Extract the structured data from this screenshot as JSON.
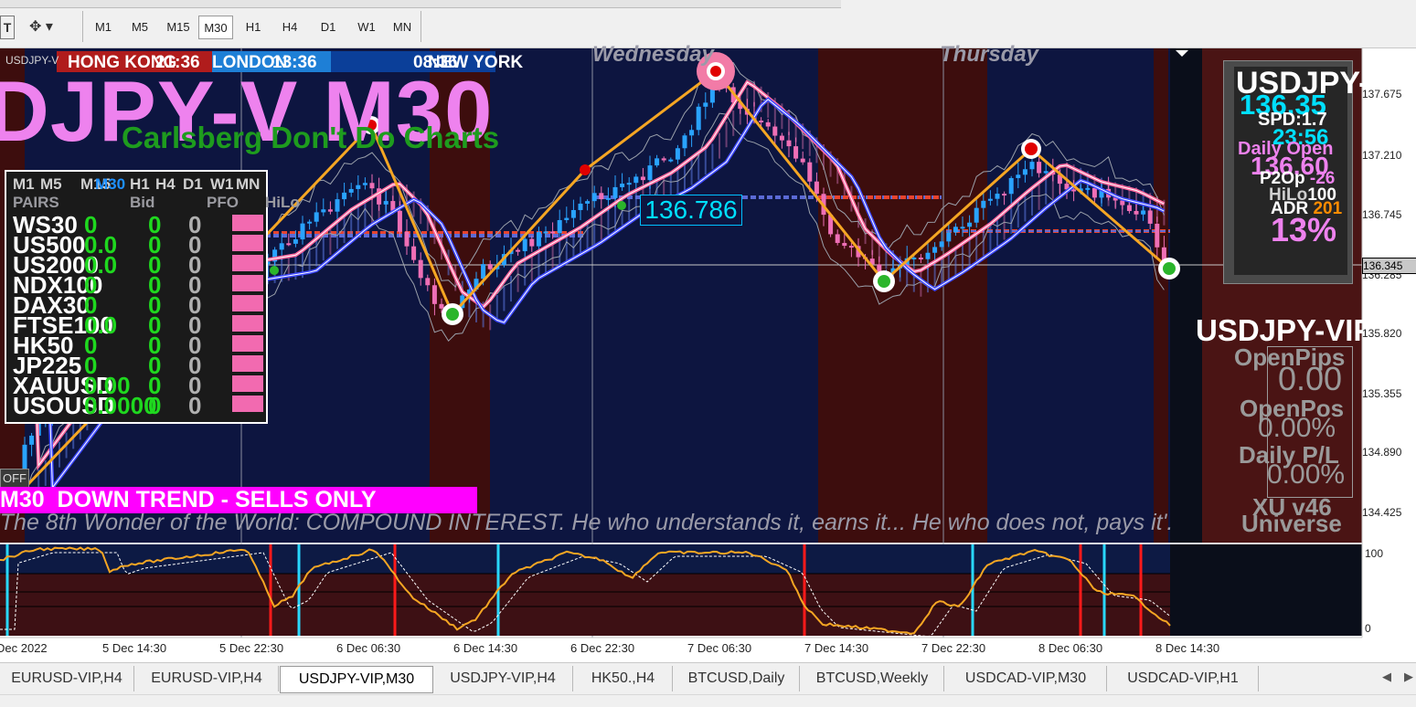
{
  "toolbar": {
    "timeframes": [
      "M1",
      "M5",
      "M15",
      "M30",
      "H1",
      "H4",
      "D1",
      "W1",
      "MN"
    ],
    "active_timeframe": "M30"
  },
  "chart": {
    "symbol_small": "USDJPY-V",
    "big_title": "DJPY-V M30",
    "subtitle": "Carlsberg Don't Do Charts",
    "days": [
      "Wednesday",
      "Thursday"
    ],
    "sessions": {
      "hong_kong": "HONG KONG",
      "hk_time": "21:36",
      "london": "LONDON",
      "london_time": "13:36",
      "new_york": "NEW YORK",
      "ny_time": "08:36"
    },
    "level_label": "136.786",
    "trend_banner": "M30  DOWN TREND - SELLS ONLY",
    "quote": "'The 8th Wonder of the World: COMPOUND INTEREST. He who understands it, earns it... He who does not, pays it'.",
    "off_button": "OFF",
    "colors": {
      "bg": "#0d1540",
      "dark_red": "#3d0d0d",
      "bull": "#29a3ff",
      "bear": "#ef6fb6",
      "zigzag": "#f5a623",
      "banner": "#ff00ff"
    }
  },
  "dashboard": {
    "timeframes": [
      "M1",
      "M5",
      "M15",
      "M30",
      "H1",
      "H4",
      "D1",
      "W1",
      "MN"
    ],
    "active_tf": "M30",
    "headers": [
      "PAIRS",
      "Bid",
      "PFO",
      "HiLo"
    ],
    "rows": [
      {
        "pair": "WS30",
        "bid": "0",
        "pfo": "0",
        "hilo": "0"
      },
      {
        "pair": "US500",
        "bid": "0.0",
        "pfo": "0",
        "hilo": "0"
      },
      {
        "pair": "US2000",
        "bid": "0.0",
        "pfo": "0",
        "hilo": "0"
      },
      {
        "pair": "NDX100",
        "bid": "0",
        "pfo": "0",
        "hilo": "0"
      },
      {
        "pair": "DAX30",
        "bid": "0",
        "pfo": "0",
        "hilo": "0"
      },
      {
        "pair": "FTSE100",
        "bid": "0.0",
        "pfo": "0",
        "hilo": "0"
      },
      {
        "pair": "HK50",
        "bid": "0",
        "pfo": "0",
        "hilo": "0"
      },
      {
        "pair": "JP225",
        "bid": "0",
        "pfo": "0",
        "hilo": "0"
      },
      {
        "pair": "XAUUSD",
        "bid": "0.00",
        "pfo": "0",
        "hilo": "0"
      },
      {
        "pair": "USOUSD",
        "bid": "0.0000",
        "pfo": "0",
        "hilo": "0"
      }
    ]
  },
  "info_panel": {
    "symbol": "USDJPY-",
    "price": "136.35",
    "spread_label": "SPD",
    "spread": "1.7",
    "time": "23:56",
    "daily_open_label": "Daily Open",
    "daily_open": "136.60",
    "p2op_label": "P2Op",
    "p2op": "-26",
    "hilo_label": "HiLo",
    "hilo": "100",
    "adr_label": "ADR",
    "adr": "201",
    "percent": "13%"
  },
  "account_panel": {
    "symbol": "USDJPY-VIP",
    "open_pips_label": "OpenPips",
    "open_pips": "0.00",
    "open_pos_label": "OpenPos",
    "open_pos": "0.00%",
    "daily_pl_label": "Daily P/L",
    "daily_pl": "0.00%",
    "version": "XU v46",
    "universe": "Universe"
  },
  "price_axis": {
    "labels": [
      "137.675",
      "137.210",
      "136.745",
      "136.285",
      "135.820",
      "135.355",
      "134.890",
      "134.425"
    ],
    "current": "136.345"
  },
  "osc_axis": {
    "labels": [
      "100",
      "0"
    ]
  },
  "time_axis": {
    "labels": [
      "Dec 2022",
      "5 Dec 14:30",
      "5 Dec 22:30",
      "6 Dec 06:30",
      "6 Dec 14:30",
      "6 Dec 22:30",
      "7 Dec 06:30",
      "7 Dec 14:30",
      "7 Dec 22:30",
      "8 Dec 06:30",
      "8 Dec 14:30"
    ]
  },
  "tabs": [
    "EURUSD-VIP,H4",
    "EURUSD-VIP,H4",
    "USDJPY-VIP,M30",
    "USDJPY-VIP,H4",
    "HK50.,H4",
    "BTCUSD,Daily",
    "BTCUSD,Weekly",
    "USDCAD-VIP,M30",
    "USDCAD-VIP,H1"
  ],
  "active_tab": "USDJPY-VIP,M30"
}
